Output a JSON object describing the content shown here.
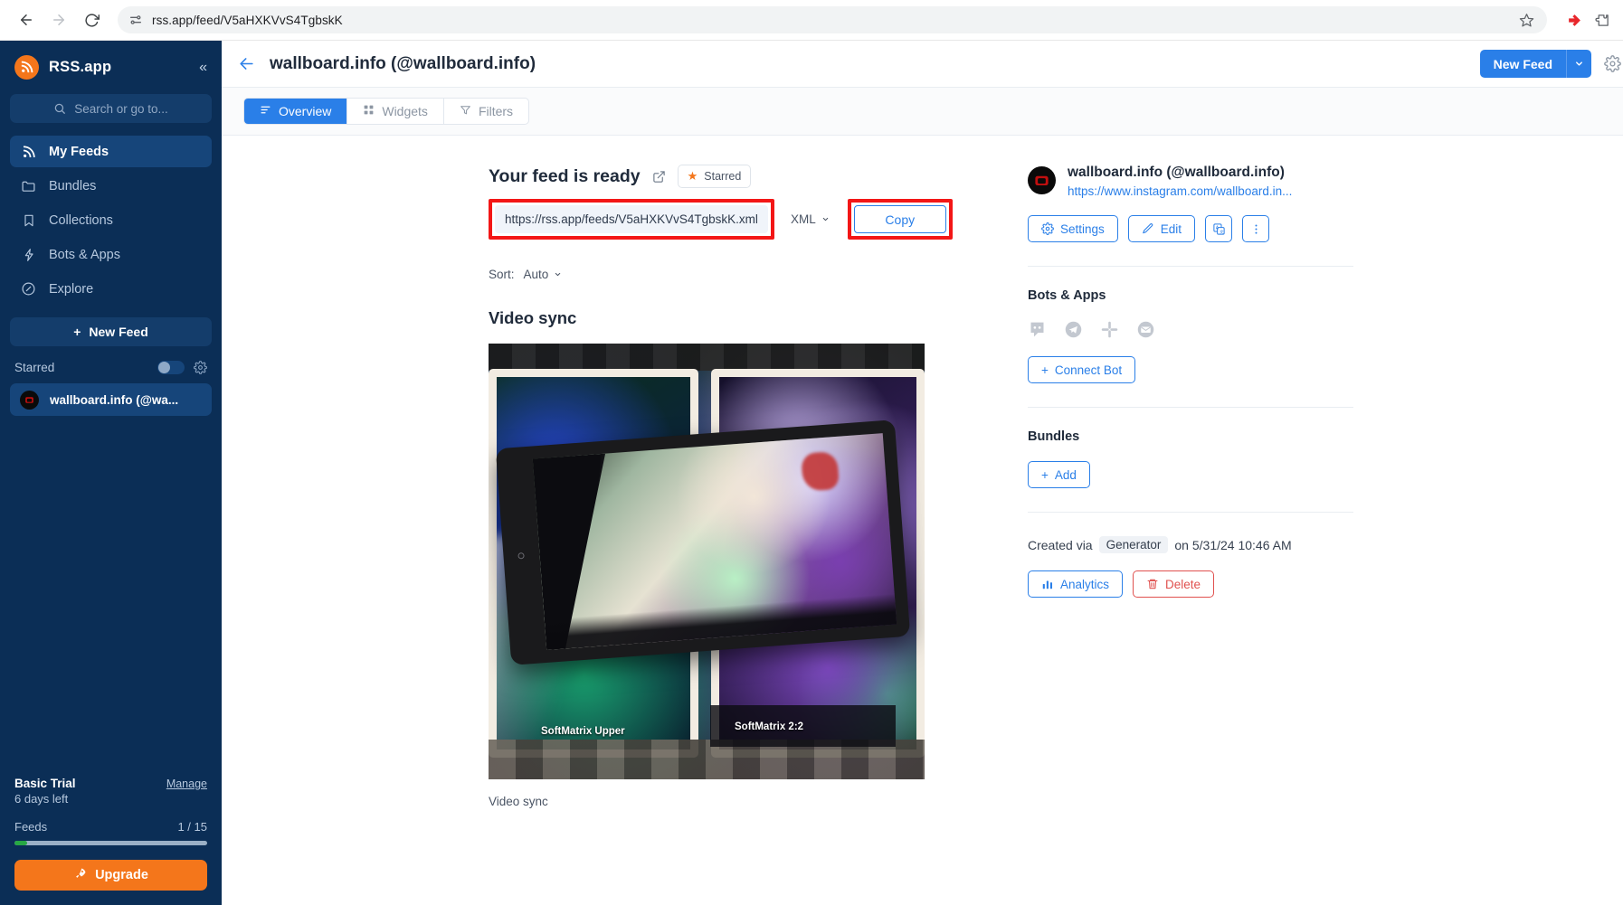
{
  "browser": {
    "url": "rss.app/feed/V5aHXKVvS4TgbskK",
    "back_icon": "back-arrow-icon",
    "forward_icon": "forward-arrow-icon",
    "reload_icon": "reload-icon",
    "site_settings_icon": "tune-icon",
    "bookmark_icon": "star-icon",
    "extension_icon": "extension-icon",
    "puzzle_icon": "puzzle-icon"
  },
  "sidebar": {
    "brand": "RSS.app",
    "collapse_label": "«",
    "search_placeholder": "Search or go to...",
    "items": [
      {
        "label": "My Feeds",
        "icon": "rss-icon",
        "active": true
      },
      {
        "label": "Bundles",
        "icon": "folder-icon",
        "active": false
      },
      {
        "label": "Collections",
        "icon": "bookmark-icon",
        "active": false
      },
      {
        "label": "Bots & Apps",
        "icon": "bolt-icon",
        "active": false
      },
      {
        "label": "Explore",
        "icon": "compass-icon",
        "active": false
      }
    ],
    "new_feed_label": "New Feed",
    "starred_label": "Starred",
    "feed_item": "wallboard.info (@wa...",
    "trial": {
      "plan": "Basic Trial",
      "manage": "Manage",
      "days_left": "6 days left",
      "feeds_label": "Feeds",
      "feeds_count": "1 / 15",
      "upgrade": "Upgrade",
      "progress_percent": 6.6,
      "progress_color": "#27a844"
    }
  },
  "header": {
    "title": "wallboard.info (@wallboard.info)",
    "back_icon": "back-arrow-icon",
    "new_feed_label": "New Feed",
    "new_feed_caret": "chevron-down-icon",
    "gear_icon": "gear-icon",
    "accent_color": "#2a7fe8"
  },
  "tabs": [
    {
      "label": "Overview",
      "icon": "list-icon",
      "active": true
    },
    {
      "label": "Widgets",
      "icon": "grid-icon",
      "active": false
    },
    {
      "label": "Filters",
      "icon": "funnel-icon",
      "active": false
    }
  ],
  "feed_ready": {
    "title": "Your feed is ready",
    "external_link_icon": "external-link-icon",
    "starred_chip": "Starred",
    "star_icon": "star-filled-icon",
    "url_value": "https://rss.app/feeds/V5aHXKVvS4TgbskK.xml",
    "format_label": "XML",
    "format_caret": "chevron-down-icon",
    "copy_label": "Copy",
    "highlight_color": "#f31616"
  },
  "sort": {
    "label": "Sort:",
    "value": "Auto",
    "caret": "chevron-down-icon"
  },
  "item": {
    "title": "Video sync",
    "caption": "Video sync",
    "image_labels": {
      "upper": "SoftMatrix Upper",
      "lower": "SoftMatrix 2:2"
    }
  },
  "right_panel": {
    "feed_name": "wallboard.info (@wallboard.info)",
    "feed_url": "https://www.instagram.com/wallboard.in...",
    "buttons": [
      {
        "label": "Settings",
        "icon": "gear-icon"
      },
      {
        "label": "Edit",
        "icon": "pencil-icon"
      },
      {
        "label": "",
        "icon": "translate-icon"
      },
      {
        "label": "",
        "icon": "more-vertical-icon"
      }
    ],
    "bots_title": "Bots & Apps",
    "bot_icons": [
      "discord-icon",
      "telegram-icon",
      "slack-icon",
      "email-icon"
    ],
    "connect_bot_label": "Connect Bot",
    "bundles_title": "Bundles",
    "add_label": "Add",
    "created_prefix": "Created via",
    "created_source": "Generator",
    "created_suffix": "on 5/31/24 10:46 AM",
    "analytics_label": "Analytics",
    "analytics_icon": "bar-chart-icon",
    "delete_label": "Delete",
    "delete_icon": "trash-icon"
  }
}
